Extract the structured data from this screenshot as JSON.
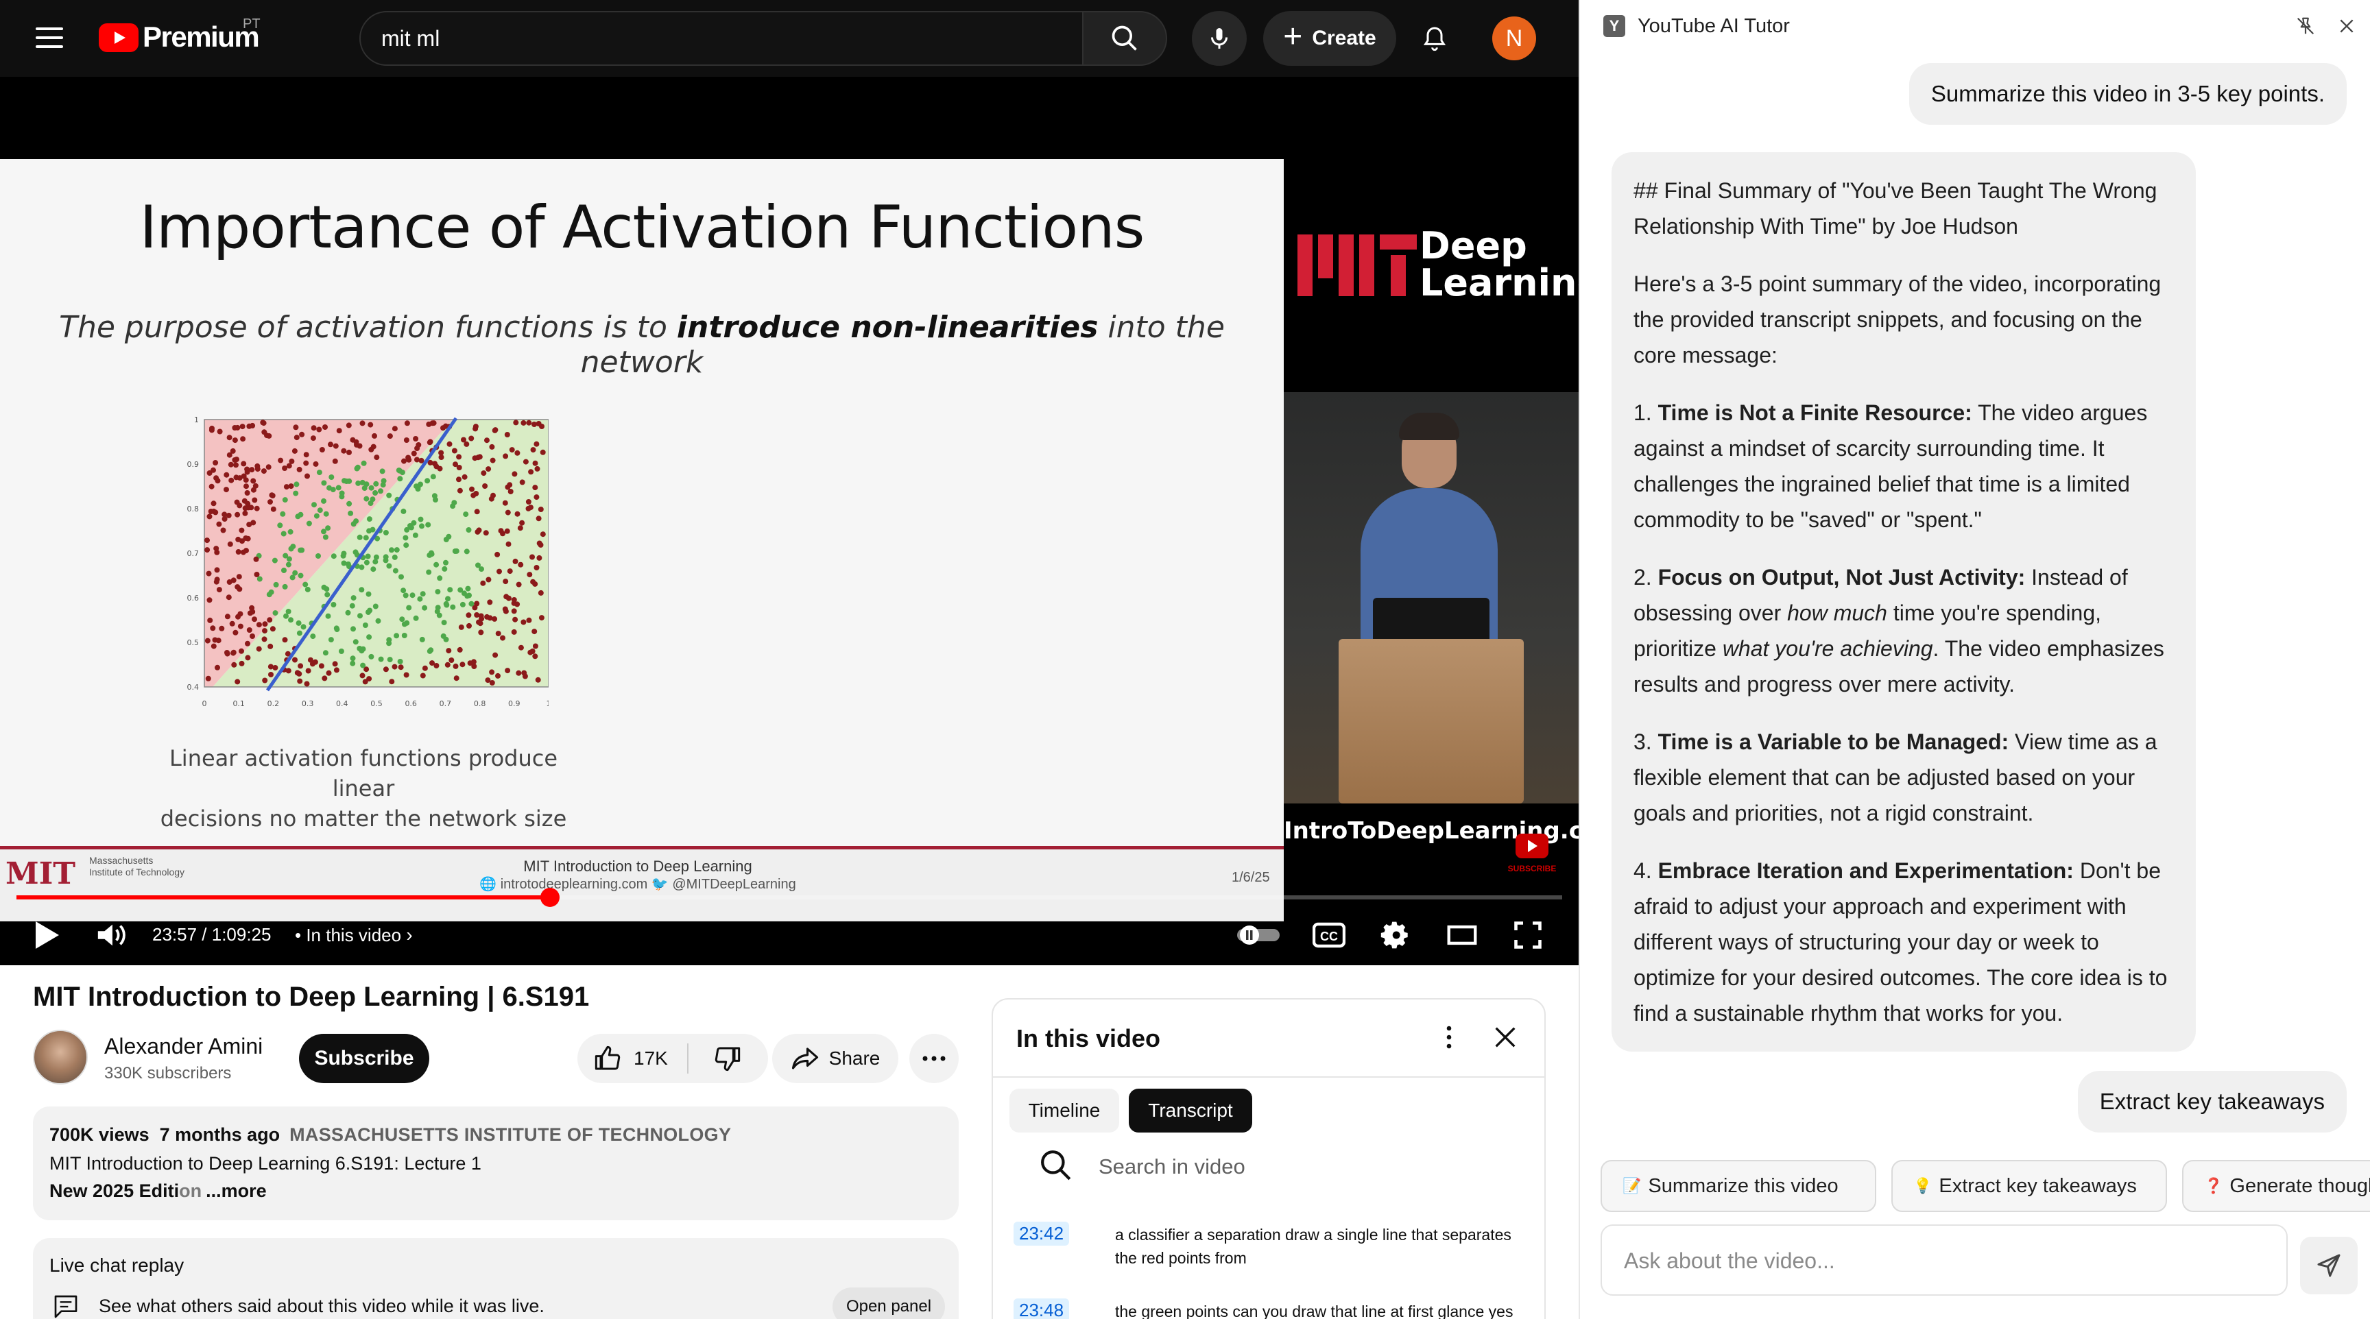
{
  "header": {
    "logo_text": "Premium",
    "country_code": "PT",
    "search_value": "mit ml",
    "create_label": "Create",
    "avatar_letter": "N"
  },
  "player": {
    "slide": {
      "title": "Importance of Activation Functions",
      "subtitle_pre": "The purpose of activation functions is to ",
      "subtitle_bold": "introduce non-linearities",
      "subtitle_post": " into the network",
      "caption_line1": "Linear activation functions produce linear",
      "caption_line2": "decisions no matter the network size",
      "footer_mit": "MIT",
      "footer_institute": "Massachusetts Institute of Technology",
      "footer_course": "MIT Introduction to Deep Learning",
      "footer_web": "introtodeeplearning.com",
      "footer_handle": "@MITDeepLearning",
      "footer_date": "1/6/25",
      "plot_x_ticks": [
        "0",
        "0.1",
        "0.2",
        "0.3",
        "0.4",
        "0.5",
        "0.6",
        "0.7",
        "0.8",
        "0.9",
        "1"
      ],
      "plot_y_ticks": [
        "0.4",
        "0.5",
        "0.6",
        "0.7",
        "0.8",
        "0.9",
        "1"
      ]
    },
    "brand": {
      "mit": "MIT",
      "deep": "Deep",
      "learning": "Learning",
      "url": "IntroToDeepLearning.com"
    },
    "subscribe_badge": "SUBSCRIBE",
    "time_current": "23:57",
    "time_total": "1:09:25",
    "time_display": "23:57 / 1:09:25",
    "chapter_label": "• In this video",
    "progress_fraction": 0.345,
    "accent_color": "#ff0000"
  },
  "video": {
    "title": "MIT Introduction to Deep Learning | 6.S191",
    "channel_name": "Alexander Amini",
    "subscribers": "330K subscribers",
    "subscribe_label": "Subscribe",
    "likes": "17K",
    "share_label": "Share",
    "views": "700K views",
    "age": "7 months ago",
    "org": "MASSACHUSETTS INSTITUTE OF TECHNOLOGY",
    "desc_line2": "MIT Introduction to Deep Learning 6.S191: Lecture 1",
    "desc_line3_a": "New 2025 Editi",
    "desc_line3_b": "on",
    "desc_more": "...more"
  },
  "chat_replay": {
    "title": "Live chat replay",
    "description": "See what others said about this video while it was live.",
    "open_panel": "Open panel"
  },
  "in_this_video": {
    "title": "In this video",
    "tabs": [
      {
        "label": "Timeline",
        "active": false
      },
      {
        "label": "Transcript",
        "active": true
      }
    ],
    "search_placeholder": "Search in video",
    "transcript": [
      {
        "time": "23:42",
        "text": "a classifier a separation draw a single line that separates the red points from"
      },
      {
        "time": "23:48",
        "text": "the green points can you draw that line at first glance yes"
      }
    ]
  },
  "tutor": {
    "favicon_letter": "Y",
    "title": "YouTube AI Tutor",
    "user_message_1": "Summarize this video in 3-5 key points.",
    "ai_heading": "## Final Summary of \"You've Been Taught The Wrong Relationship With Time\" by Joe Hudson",
    "ai_intro": "Here's a 3-5 point summary of the video, incorporating the provided transcript snippets, and focusing on the core message:",
    "points": [
      {
        "num": "1.",
        "bold": "Time is Not a Finite Resource:",
        "text": " The video argues against a mindset of scarcity surrounding time. It challenges the ingrained belief that time is a limited commodity to be \"saved\" or \"spent.\""
      },
      {
        "num": "2.",
        "bold": "Focus on Output, Not Just Activity:",
        "text_a": " Instead of obsessing over ",
        "em_a": "how much",
        "text_b": " time you're spending, prioritize ",
        "em_b": "what you're achieving",
        "text_c": ". The video emphasizes results and progress over mere activity."
      },
      {
        "num": "3.",
        "bold": "Time is a Variable to be Managed:",
        "text": " View time as a flexible element that can be adjusted based on your goals and priorities, not a rigid constraint."
      },
      {
        "num": "4.",
        "bold": "Embrace Iteration and Experimentation:",
        "text": " Don't be afraid to adjust your approach and experiment with different ways of structuring your day or week to optimize for your desired outcomes. The core idea is to find a sustainable rhythm that works for you."
      }
    ],
    "user_message_2": "Extract key takeaways",
    "chips": [
      {
        "emoji": "📝",
        "label": "Summarize this video"
      },
      {
        "emoji": "💡",
        "label": "Extract key takeaways"
      },
      {
        "emoji": "❓",
        "label": "Generate thought"
      }
    ],
    "input_placeholder": "Ask about the video..."
  }
}
